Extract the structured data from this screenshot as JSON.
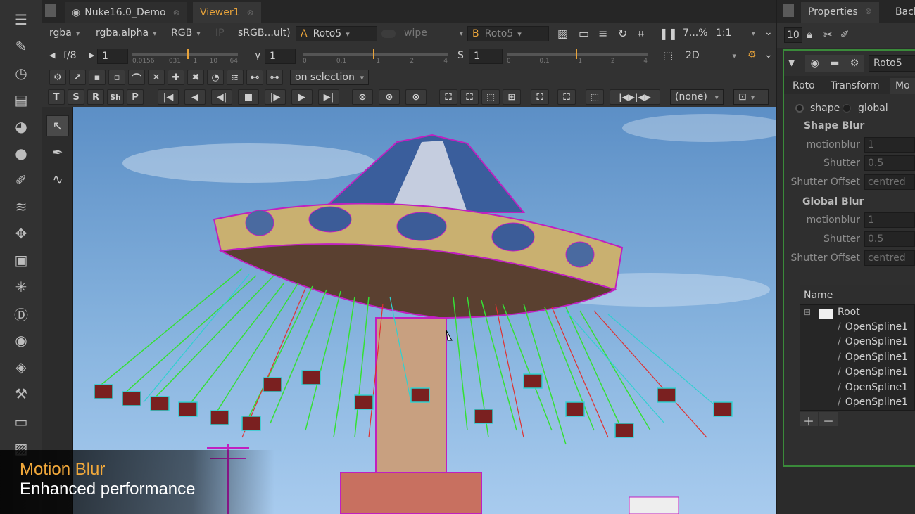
{
  "tabs": {
    "script": "Nuke16.0_Demo",
    "viewer": "Viewer1"
  },
  "viewer_row1": {
    "channels": "rgba",
    "alpha": "rgba.alpha",
    "display": "RGB",
    "ip": "IP",
    "lut": "sRGB...ult)",
    "input_a_letter": "A",
    "input_a": "Roto5",
    "wipe": "wipe",
    "input_b_letter": "B",
    "input_b": "Roto5",
    "zoom": "7...%",
    "ratio": "1:1"
  },
  "viewer_row2": {
    "fstop": "f/8",
    "frame": "1",
    "gain_ticks": [
      "0.0156",
      ".031",
      "1",
      "10",
      "64"
    ],
    "gamma_label": "γ",
    "gamma": "1",
    "gamma_ticks": [
      "0",
      "0.1",
      "1",
      "2",
      "4"
    ],
    "sat_label": "S",
    "sat": "1",
    "sat_ticks": [
      "0",
      "0.1",
      "1",
      "2",
      "4"
    ],
    "view_mode": "2D"
  },
  "roto_toolbar": {
    "selection_mode": "on selection",
    "letter_buttons": [
      "T",
      "S",
      "R",
      "Sh",
      "P"
    ],
    "track_range": "(none)"
  },
  "properties": {
    "title": "Properties",
    "back_tab": "Back",
    "max_panels": "10",
    "node_name": "Roto5",
    "tabs": [
      "Roto",
      "Transform",
      "Mo"
    ],
    "blur_mode_shape": "shape",
    "blur_mode_global": "global",
    "shape_blur_header": "Shape Blur",
    "global_blur_header": "Global Blur",
    "shape_blur": {
      "motionblur_label": "motionblur",
      "motionblur": "1",
      "shutter_label": "Shutter",
      "shutter": "0.5",
      "offset_label": "Shutter Offset",
      "offset": "centred"
    },
    "global_blur": {
      "motionblur_label": "motionblur",
      "motionblur": "1",
      "shutter_label": "Shutter",
      "shutter": "0.5",
      "offset_label": "Shutter Offset",
      "offset": "centred"
    },
    "tree_header": "Name",
    "tree_root": "Root",
    "tree_items": [
      "OpenSpline1",
      "OpenSpline1",
      "OpenSpline1",
      "OpenSpline1",
      "OpenSpline1",
      "OpenSpline1"
    ]
  },
  "caption": {
    "title": "Motion Blur",
    "subtitle": "Enhanced performance"
  },
  "colors": {
    "accent_orange": "#e8a33a",
    "roto_magenta": "#c020c0",
    "roto_green": "#35e035",
    "roto_red": "#e03030",
    "roto_cyan": "#30d0d0"
  },
  "icons": [
    "menu-icon",
    "paint-icon",
    "clock-icon",
    "layers-icon",
    "channel-icon",
    "sphere-icon",
    "color-icon",
    "stack-icon",
    "move-icon",
    "cube-icon",
    "particle-icon",
    "deep-icon",
    "eye-icon",
    "tag-icon",
    "wrench-icon",
    "drawer-icon",
    "gallery-icon"
  ]
}
